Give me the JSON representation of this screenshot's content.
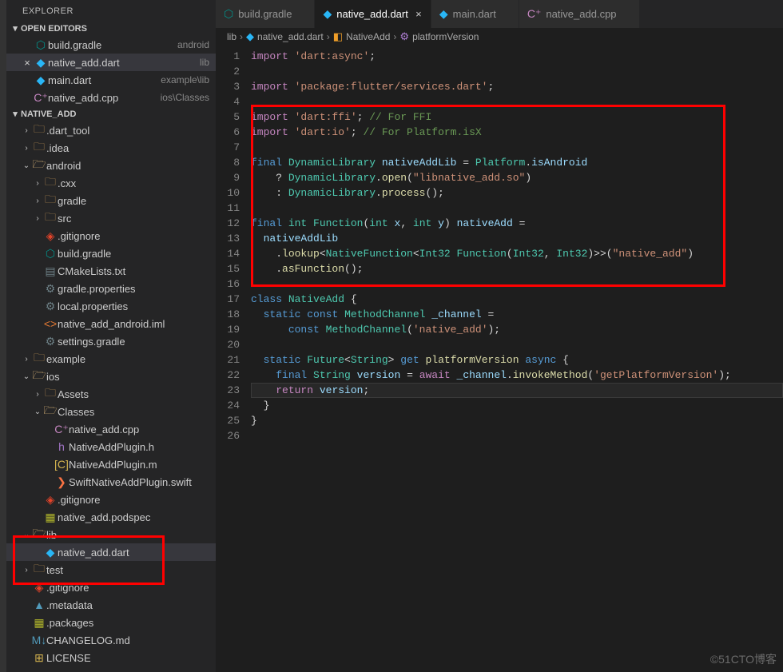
{
  "sidebar": {
    "title": "EXPLORER",
    "sections": {
      "openEditors": "OPEN EDITORS",
      "project": "NATIVE_ADD"
    },
    "editors": [
      {
        "icon": "gradle",
        "name": "build.gradle",
        "desc": "android"
      },
      {
        "icon": "dart",
        "name": "native_add.dart",
        "desc": "lib",
        "active": true
      },
      {
        "icon": "dart",
        "name": "main.dart",
        "desc": "example\\lib"
      },
      {
        "icon": "cpp",
        "name": "native_add.cpp",
        "desc": "ios\\Classes"
      }
    ],
    "tree": [
      {
        "d": 1,
        "t": "folder",
        "exp": false,
        "name": ".dart_tool"
      },
      {
        "d": 1,
        "t": "folder",
        "exp": false,
        "name": ".idea"
      },
      {
        "d": 1,
        "t": "folder-open",
        "exp": true,
        "name": "android"
      },
      {
        "d": 2,
        "t": "folder",
        "exp": false,
        "name": ".cxx"
      },
      {
        "d": 2,
        "t": "folder",
        "exp": false,
        "name": "gradle"
      },
      {
        "d": 2,
        "t": "folder",
        "exp": false,
        "name": "src"
      },
      {
        "d": 2,
        "t": "git",
        "name": ".gitignore"
      },
      {
        "d": 2,
        "t": "gradle",
        "name": "build.gradle"
      },
      {
        "d": 2,
        "t": "txt",
        "name": "CMakeLists.txt"
      },
      {
        "d": 2,
        "t": "settings-file",
        "name": "gradle.properties"
      },
      {
        "d": 2,
        "t": "settings-file",
        "name": "local.properties"
      },
      {
        "d": 2,
        "t": "xml",
        "name": "native_add_android.iml"
      },
      {
        "d": 2,
        "t": "settings-file",
        "name": "settings.gradle"
      },
      {
        "d": 1,
        "t": "folder",
        "exp": false,
        "name": "example"
      },
      {
        "d": 1,
        "t": "folder-open",
        "exp": true,
        "name": "ios"
      },
      {
        "d": 2,
        "t": "folder",
        "exp": false,
        "name": "Assets"
      },
      {
        "d": 2,
        "t": "folder-open",
        "exp": true,
        "name": "Classes"
      },
      {
        "d": 3,
        "t": "cpp",
        "name": "native_add.cpp"
      },
      {
        "d": 3,
        "t": "h",
        "name": "NativeAddPlugin.h"
      },
      {
        "d": 3,
        "t": "m",
        "name": "NativeAddPlugin.m"
      },
      {
        "d": 3,
        "t": "swift",
        "name": "SwiftNativeAddPlugin.swift"
      },
      {
        "d": 2,
        "t": "git",
        "name": ".gitignore"
      },
      {
        "d": 2,
        "t": "pkg",
        "name": "native_add.podspec"
      },
      {
        "d": 1,
        "t": "folder-open",
        "exp": true,
        "name": "lib"
      },
      {
        "d": 2,
        "t": "dart",
        "name": "native_add.dart",
        "active": true
      },
      {
        "d": 1,
        "t": "folder",
        "exp": false,
        "name": "test"
      },
      {
        "d": 1,
        "t": "git",
        "name": ".gitignore"
      },
      {
        "d": 1,
        "t": "meta",
        "name": ".metadata"
      },
      {
        "d": 1,
        "t": "pkg",
        "name": ".packages"
      },
      {
        "d": 1,
        "t": "md",
        "name": "CHANGELOG.md"
      },
      {
        "d": 1,
        "t": "lic",
        "name": "LICENSE"
      }
    ]
  },
  "tabs": [
    {
      "icon": "gradle",
      "label": "build.gradle"
    },
    {
      "icon": "dart",
      "label": "native_add.dart",
      "active": true,
      "close": true
    },
    {
      "icon": "dart",
      "label": "main.dart"
    },
    {
      "icon": "cpp",
      "label": "native_add.cpp"
    }
  ],
  "breadcrumb": {
    "p1": "lib",
    "p2": "native_add.dart",
    "p3": "NativeAdd",
    "p4": "platformVersion"
  },
  "code": {
    "lines": [
      "<span class='ctl'>import</span> <span class='str'>'dart:async'</span>;",
      "",
      "<span class='ctl'>import</span> <span class='str'>'package:flutter/services.dart'</span>;",
      "",
      "<span class='ctl'>import</span> <span class='str'>'dart:ffi'</span>; <span class='cmt'>// For FFI</span>",
      "<span class='ctl'>import</span> <span class='str'>'dart:io'</span>; <span class='cmt'>// For Platform.isX</span>",
      "",
      "<span class='kw'>final</span> <span class='cls'>DynamicLibrary</span> <span class='var'>nativeAddLib</span> = <span class='cls'>Platform</span>.<span class='var'>isAndroid</span>",
      "    ? <span class='cls'>DynamicLibrary</span>.<span class='fn'>open</span>(<span class='str'>\"libnative_add.so\"</span>)",
      "    : <span class='cls'>DynamicLibrary</span>.<span class='fn'>process</span>();",
      "",
      "<span class='kw'>final</span> <span class='cls'>int</span> <span class='cls'>Function</span>(<span class='cls'>int</span> <span class='prm'>x</span>, <span class='cls'>int</span> <span class='prm'>y</span>) <span class='var'>nativeAdd</span> =",
      "  <span class='var'>nativeAddLib</span>",
      "    .<span class='fn'>lookup</span>&lt;<span class='cls'>NativeFunction</span>&lt;<span class='cls'>Int32</span> <span class='cls'>Function</span>(<span class='cls'>Int32</span>, <span class='cls'>Int32</span>)&gt;&gt;(<span class='str'>\"native_add\"</span>)",
      "    .<span class='fn'>asFunction</span>();",
      "",
      "<span class='kw'>class</span> <span class='cls'>NativeAdd</span> {",
      "  <span class='kw'>static</span> <span class='kw'>const</span> <span class='cls'>MethodChannel</span> <span class='var'>_channel</span> =",
      "      <span class='kw'>const</span> <span class='cls'>MethodChannel</span>(<span class='str'>'native_add'</span>);",
      "",
      "  <span class='kw'>static</span> <span class='cls'>Future</span>&lt;<span class='cls'>String</span>&gt; <span class='kw'>get</span> <span class='fn'>platformVersion</span> <span class='kw'>async</span> {",
      "    <span class='kw'>final</span> <span class='cls'>String</span> <span class='var'>version</span> = <span class='ctl'>await</span> <span class='var'>_channel</span>.<span class='fn'>invokeMethod</span>(<span class='str'>'getPlatformVersion'</span>);",
      "    <span class='ctl'>return</span> <span class='var'>version</span>;",
      "  }",
      "}",
      ""
    ]
  },
  "watermark": "©51CTO博客"
}
